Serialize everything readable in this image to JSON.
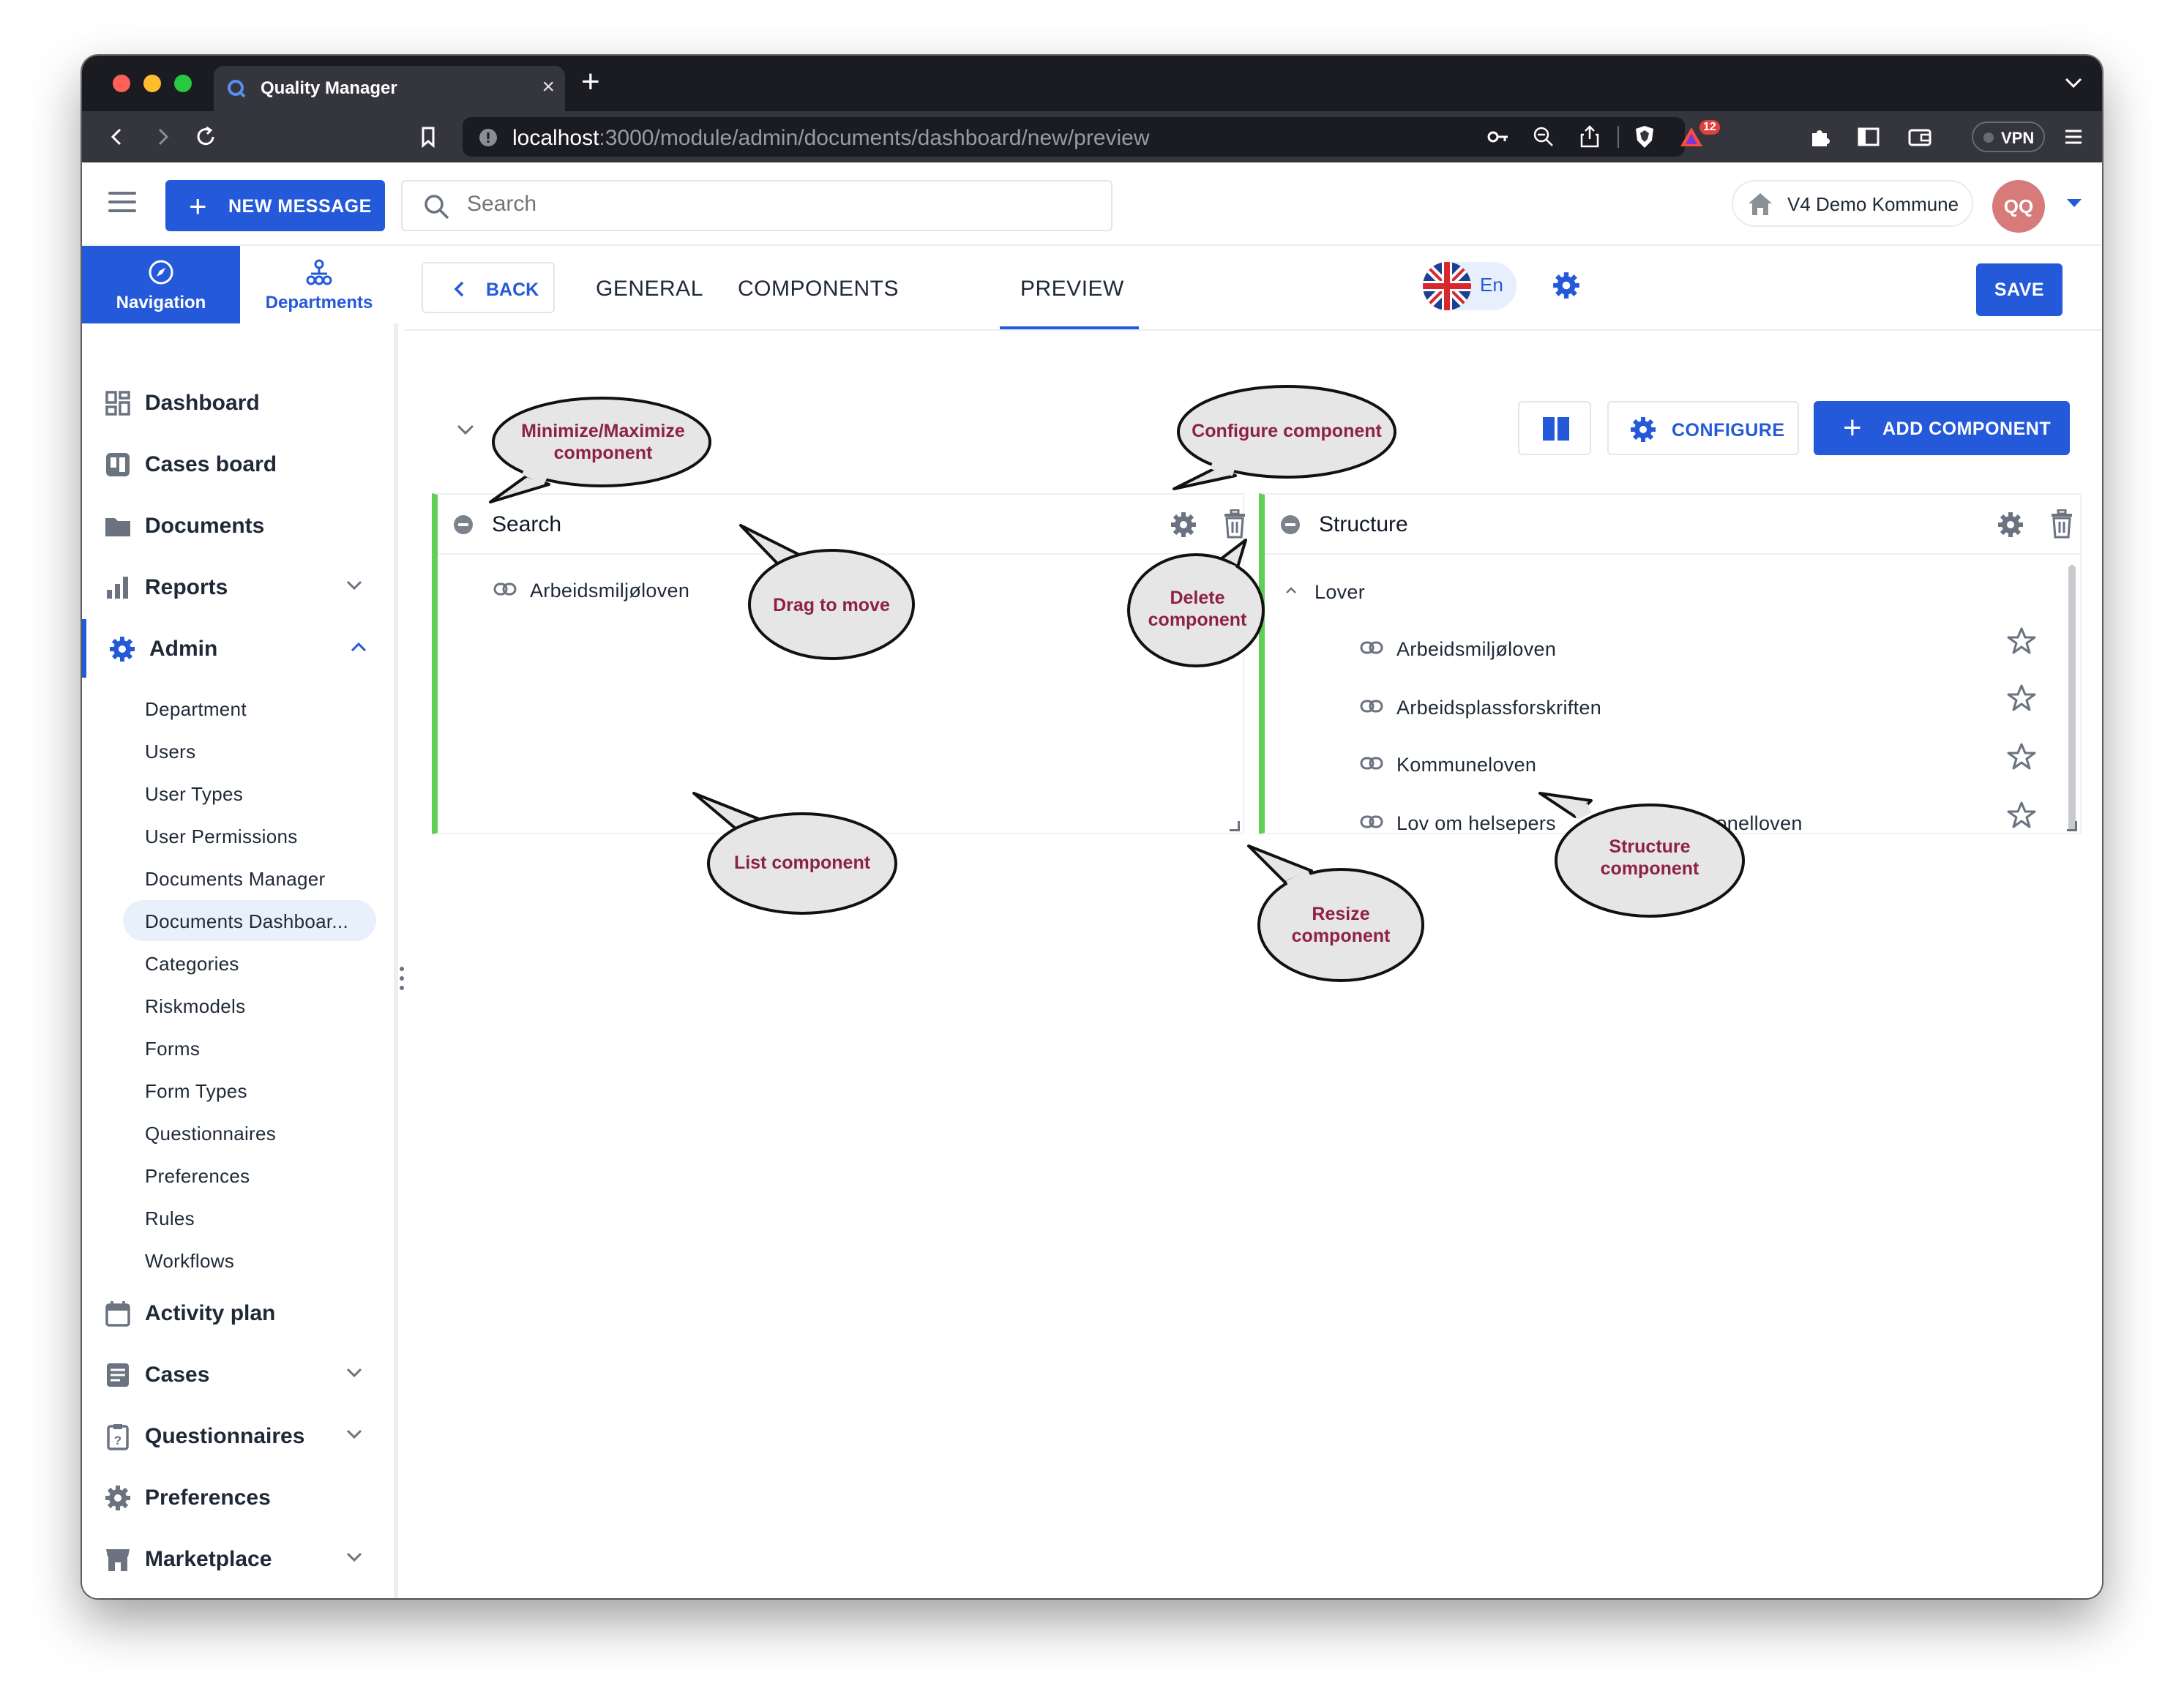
{
  "browser": {
    "tab_title": "Quality Manager",
    "url_host": "localhost",
    "url_rest": ":3000/module/admin/documents/dashboard/new/preview",
    "vpn_label": "VPN",
    "brave_badge": "12"
  },
  "appbar": {
    "new_message_label": "NEW MESSAGE",
    "search_placeholder": "Search",
    "tenant_label": "V4 Demo Kommune",
    "avatar_initials": "QQ"
  },
  "sidebar": {
    "tabs": [
      {
        "label": "Navigation",
        "icon": "compass-icon"
      },
      {
        "label": "Departments",
        "icon": "org-chart-icon"
      }
    ],
    "items": [
      {
        "label": "Dashboard",
        "icon": "grid-icon"
      },
      {
        "label": "Cases board",
        "icon": "board-icon"
      },
      {
        "label": "Documents",
        "icon": "folder-icon"
      },
      {
        "label": "Reports",
        "icon": "bar-chart-icon"
      },
      {
        "label": "Admin",
        "icon": "admin-gear-icon"
      },
      {
        "label": "Activity plan",
        "icon": "calendar-icon"
      },
      {
        "label": "Cases",
        "icon": "cases-icon"
      },
      {
        "label": "Questionnaires",
        "icon": "clipboard-icon"
      },
      {
        "label": "Preferences",
        "icon": "gear-icon"
      },
      {
        "label": "Marketplace",
        "icon": "store-icon"
      }
    ],
    "admin_children": [
      "Department",
      "Users",
      "User Types",
      "User Permissions",
      "Documents Manager",
      "Documents Dashboar...",
      "Categories",
      "Riskmodels",
      "Forms",
      "Form Types",
      "Questionnaires",
      "Preferences",
      "Rules",
      "Workflows"
    ]
  },
  "page": {
    "back_label": "BACK",
    "tabs": [
      "GENERAL",
      "COMPONENTS",
      "PREVIEW"
    ],
    "active_tab": "PREVIEW",
    "language_code": "En",
    "save_label": "SAVE",
    "configure_label": "CONFIGURE",
    "add_component_label": "ADD COMPONENT"
  },
  "components": [
    {
      "title": "Search",
      "rows": [
        {
          "label": "Arbeidsmiljøloven"
        }
      ]
    },
    {
      "title": "Structure",
      "group": "Lover",
      "rows": [
        {
          "label": "Arbeidsmiljøloven"
        },
        {
          "label": "Arbeidsplassforskriften"
        },
        {
          "label": "Kommuneloven"
        },
        {
          "label": "Lov om helsepersonell / Helsepersonelloven",
          "visible_left": "Lov om helsepers",
          "visible_right": "ersonelloven"
        }
      ]
    }
  ],
  "callouts": {
    "minimize": [
      "Minimize/Maximize",
      "component"
    ],
    "configure": [
      "Configure component"
    ],
    "drag": [
      "Drag to move"
    ],
    "delete": [
      "Delete",
      "component"
    ],
    "list": [
      "List component"
    ],
    "resize": [
      "Resize",
      "component"
    ],
    "structure": [
      "Structure",
      "component"
    ]
  },
  "colors": {
    "primary": "#2459d9",
    "component_border": "#5fcf55",
    "callout_text": "#8e2242",
    "callout_fill": "#e6e6e6",
    "selected_bg": "#e8f1fb"
  }
}
